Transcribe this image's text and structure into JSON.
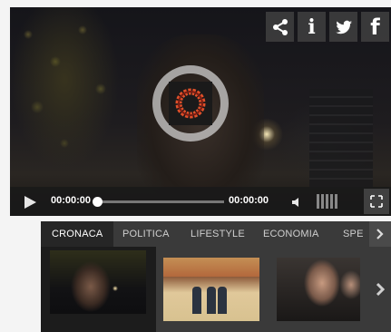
{
  "player": {
    "current_time": "00:00:00",
    "duration": "00:00:00",
    "progress_fraction": 0.0
  },
  "share": {
    "icons": [
      "share-icon",
      "info-icon",
      "twitter-icon",
      "facebook-icon"
    ],
    "info_glyph": "i",
    "facebook_glyph": "f"
  },
  "tabs": [
    {
      "label": "CRONACA",
      "active": true
    },
    {
      "label": "POLITICA",
      "active": false
    },
    {
      "label": "LIFESTYLE",
      "active": false
    },
    {
      "label": "ECONOMIA",
      "active": false
    },
    {
      "label": "SPE",
      "active": false
    }
  ],
  "colors": {
    "accent_logo": "#e0502a",
    "tab_bar": "#3a3a3a",
    "active_tab": "#262626"
  }
}
